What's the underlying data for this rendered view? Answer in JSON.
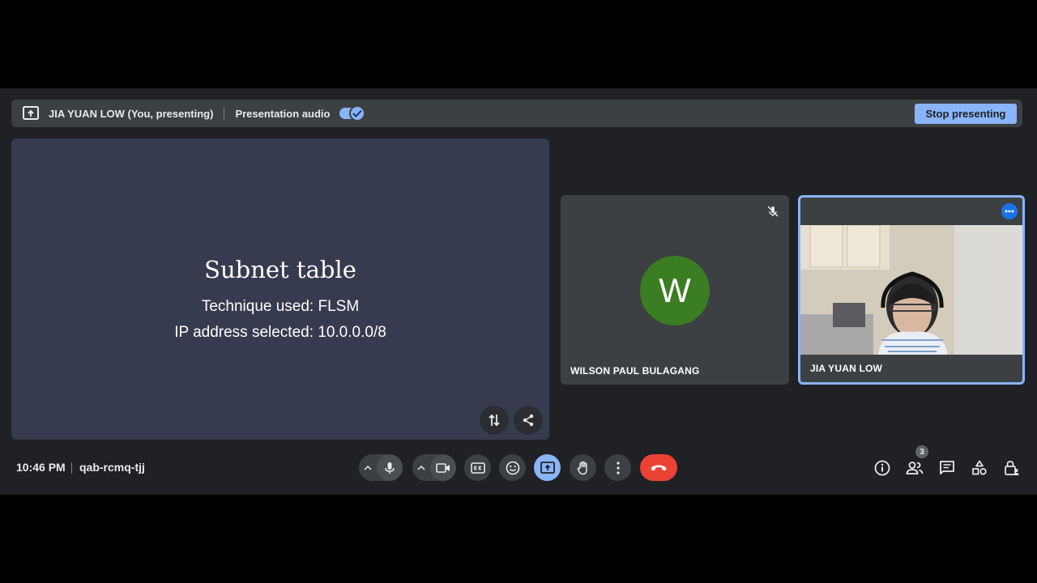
{
  "presenting_bar": {
    "presenter_label": "JIA YUAN LOW (You, presenting)",
    "audio_label": "Presentation audio",
    "audio_enabled": true,
    "stop_label": "Stop presenting"
  },
  "slide": {
    "title": "Subnet table",
    "line1": "Technique used: FLSM",
    "line2": "IP address selected: 10.0.0.0/8"
  },
  "participants": [
    {
      "name": "WILSON PAUL BULAGANG",
      "initial": "W",
      "avatar_color": "#3b7d23",
      "muted": true
    },
    {
      "name": "JIA YUAN LOW",
      "video": true,
      "active_speaker": true
    }
  ],
  "footer": {
    "time": "10:46 PM",
    "meeting_code": "qab-rcmq-tjj",
    "people_count": "3"
  },
  "colors": {
    "accent": "#8ab4f8",
    "end_call": "#ea4335",
    "background": "#202124",
    "surface": "#3c4043"
  }
}
